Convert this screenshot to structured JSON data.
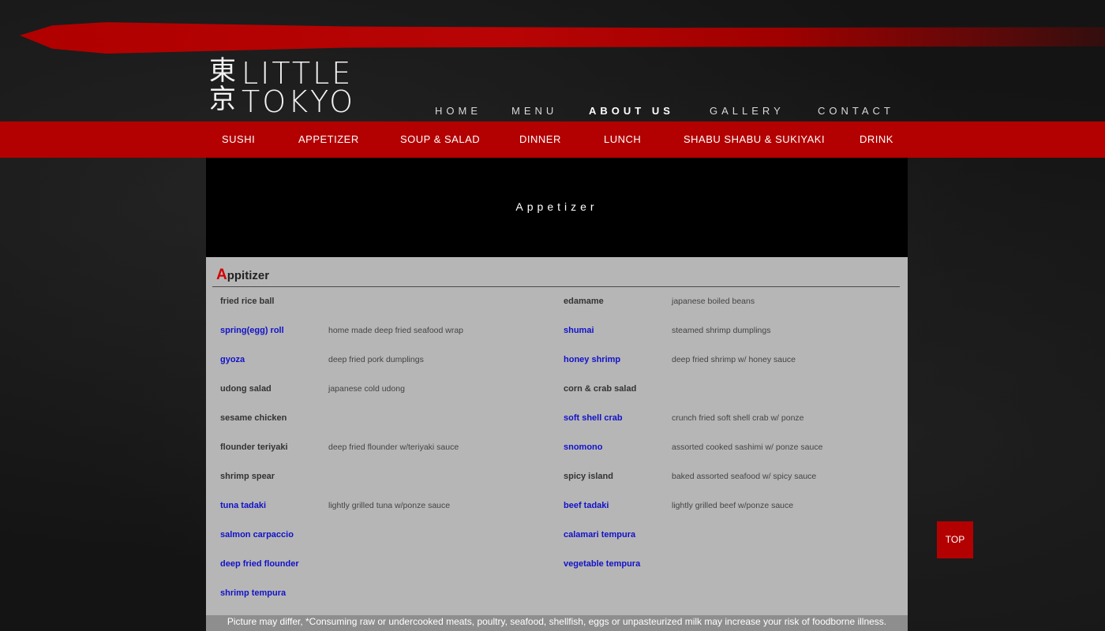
{
  "logo": {
    "kanji_top": "東",
    "kanji_bottom": "京",
    "line1": "LITTLE",
    "line2": "TOKYO"
  },
  "top_nav": [
    {
      "label": "HOME"
    },
    {
      "label": "MENU"
    },
    {
      "label": "ABOUT US"
    },
    {
      "label": "GALLERY"
    },
    {
      "label": "CONTACT"
    }
  ],
  "category_nav": [
    {
      "label": "SUSHI"
    },
    {
      "label": "APPETIZER"
    },
    {
      "label": "SOUP & SALAD"
    },
    {
      "label": "DINNER"
    },
    {
      "label": "LUNCH"
    },
    {
      "label": "SHABU SHABU & SUKIYAKI"
    },
    {
      "label": "DRINK"
    }
  ],
  "hero": {
    "title": "Appetizer"
  },
  "section": {
    "title_first": "A",
    "title_rest": "ppitizer"
  },
  "menu_left": [
    {
      "name": "fried rice ball",
      "desc": ""
    },
    {
      "name": "spring(egg) roll",
      "desc": "home made deep fried seafood wrap"
    },
    {
      "name": "gyoza",
      "desc": "deep fried pork dumplings"
    },
    {
      "name": "udong salad",
      "desc": "japanese cold udong"
    },
    {
      "name": "sesame chicken",
      "desc": ""
    },
    {
      "name": "flounder teriyaki",
      "desc": "deep fried flounder w/teriyaki sauce"
    },
    {
      "name": "shrimp spear",
      "desc": ""
    },
    {
      "name": "tuna tadaki",
      "desc": "lightly grilled tuna w/ponze sauce"
    },
    {
      "name": "salmon carpaccio",
      "desc": ""
    },
    {
      "name": "deep fried flounder",
      "desc": ""
    },
    {
      "name": "shrimp tempura",
      "desc": ""
    }
  ],
  "menu_right": [
    {
      "name": "edamame",
      "desc": "japanese boiled beans"
    },
    {
      "name": "shumai",
      "desc": "steamed shrimp dumplings"
    },
    {
      "name": "honey shrimp",
      "desc": "deep fried shrimp w/ honey sauce"
    },
    {
      "name": "corn & crab salad",
      "desc": ""
    },
    {
      "name": "soft shell crab",
      "desc": "crunch fried soft shell crab w/ ponze"
    },
    {
      "name": "snomono",
      "desc": "assorted cooked sashimi w/ ponze sauce"
    },
    {
      "name": "spicy island",
      "desc": "baked assorted seafood w/ spicy sauce"
    },
    {
      "name": "beef tadaki",
      "desc": "lightly grilled beef w/ponze sauce"
    },
    {
      "name": "calamari tempura",
      "desc": ""
    },
    {
      "name": "vegetable tempura",
      "desc": ""
    }
  ],
  "footnote": "Picture may differ, *Consuming raw or undercooked meats, poultry, seafood, shellfish, eggs or unpasteurized milk may increase your risk of foodborne illness.",
  "top_button": "TOP",
  "colors": {
    "brand_red": "#b30000",
    "link_blue": "#1212c9",
    "panel_gray": "#b6b6b6"
  }
}
